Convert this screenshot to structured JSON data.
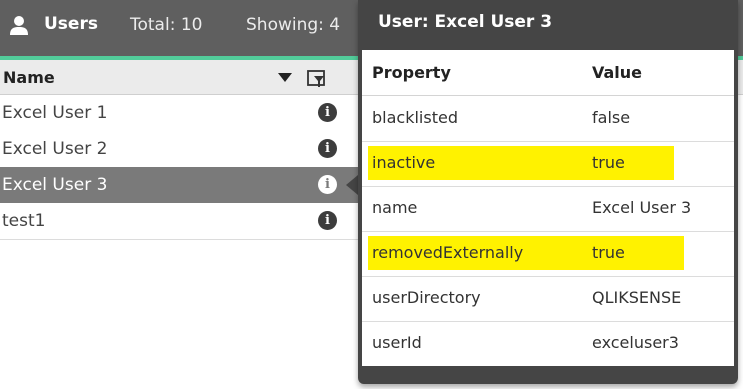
{
  "header": {
    "title": "Users",
    "total": "Total: 10",
    "showing": "Showing: 4"
  },
  "table": {
    "column_name": "Name",
    "rows": [
      "Excel User 1",
      "Excel User 2",
      "Excel User 3",
      "test1"
    ],
    "selected_index": 2
  },
  "popover": {
    "title": "User: Excel User 3",
    "col_property": "Property",
    "col_value": "Value",
    "rows": [
      {
        "property": "blacklisted",
        "value": "false"
      },
      {
        "property": "inactive",
        "value": "true"
      },
      {
        "property": "name",
        "value": "Excel User 3"
      },
      {
        "property": "removedExternally",
        "value": "true"
      },
      {
        "property": "userDirectory",
        "value": "QLIKSENSE"
      },
      {
        "property": "userId",
        "value": "exceluser3"
      }
    ]
  },
  "colors": {
    "topbar": "#5f5f5f",
    "accent": "#52cc9a",
    "selected_row": "#7a7a7a",
    "highlight": "#fff200",
    "popover_frame": "#454545"
  },
  "icons": [
    "user-icon",
    "sort-down-icon",
    "filter-icon",
    "info-icon"
  ]
}
